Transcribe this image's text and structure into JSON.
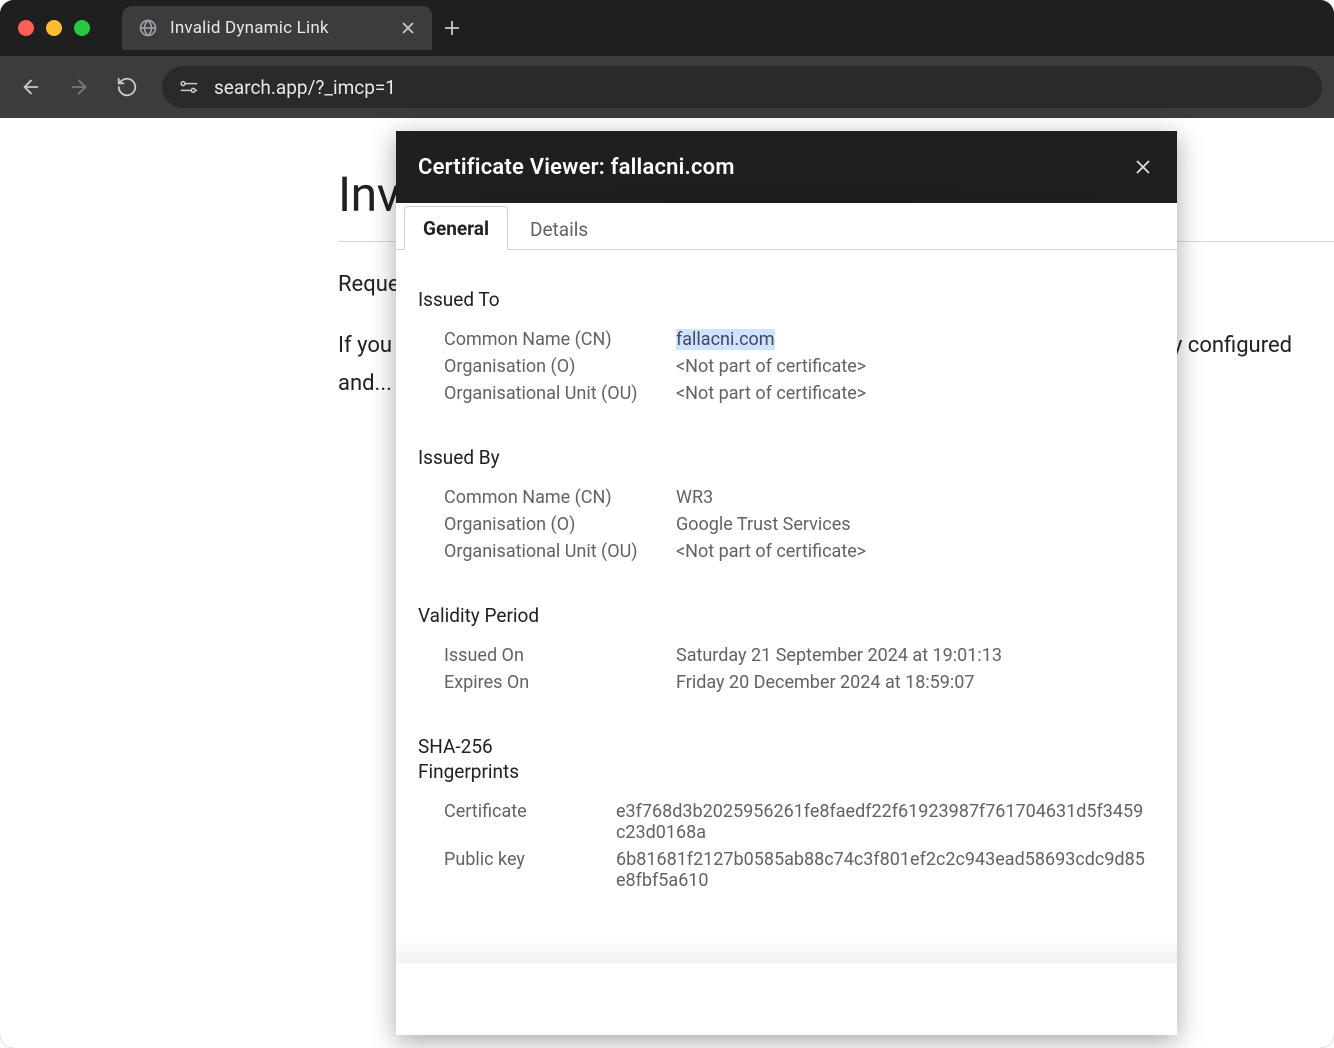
{
  "tab": {
    "title": "Invalid Dynamic Link"
  },
  "omnibox": {
    "url": "search.app/?_imcp=1"
  },
  "page": {
    "heading": "Invalid Dynamic Link",
    "line1": "Requested URL must be a parsable...",
    "line2": "If you are the developer of this app, ensure that your Dynamic Links domain is correctly configured and..."
  },
  "cert": {
    "title": "Certificate Viewer: fallacni.com",
    "tabs": {
      "general": "General",
      "details": "Details"
    },
    "issued_to": {
      "heading": "Issued To",
      "cn_label": "Common Name (CN)",
      "cn_value": "fallacni.com",
      "o_label": "Organisation (O)",
      "o_value": "<Not part of certificate>",
      "ou_label": "Organisational Unit (OU)",
      "ou_value": "<Not part of certificate>"
    },
    "issued_by": {
      "heading": "Issued By",
      "cn_label": "Common Name (CN)",
      "cn_value": "WR3",
      "o_label": "Organisation (O)",
      "o_value": "Google Trust Services",
      "ou_label": "Organisational Unit (OU)",
      "ou_value": "<Not part of certificate>"
    },
    "validity": {
      "heading": "Validity Period",
      "issued_label": "Issued On",
      "issued_value": "Saturday 21 September 2024 at 19:01:13",
      "expires_label": "Expires On",
      "expires_value": "Friday 20 December 2024 at 18:59:07"
    },
    "fingerprints": {
      "heading1": "SHA-256",
      "heading2": "Fingerprints",
      "cert_label": "Certificate",
      "cert_value": "e3f768d3b2025956261fe8faedf22f61923987f761704631d5f3459c23d0168a",
      "pubkey_label": "Public key",
      "pubkey_value": "6b81681f2127b0585ab88c74c3f801ef2c2c943ead58693cdc9d85e8fbf5a610"
    }
  }
}
